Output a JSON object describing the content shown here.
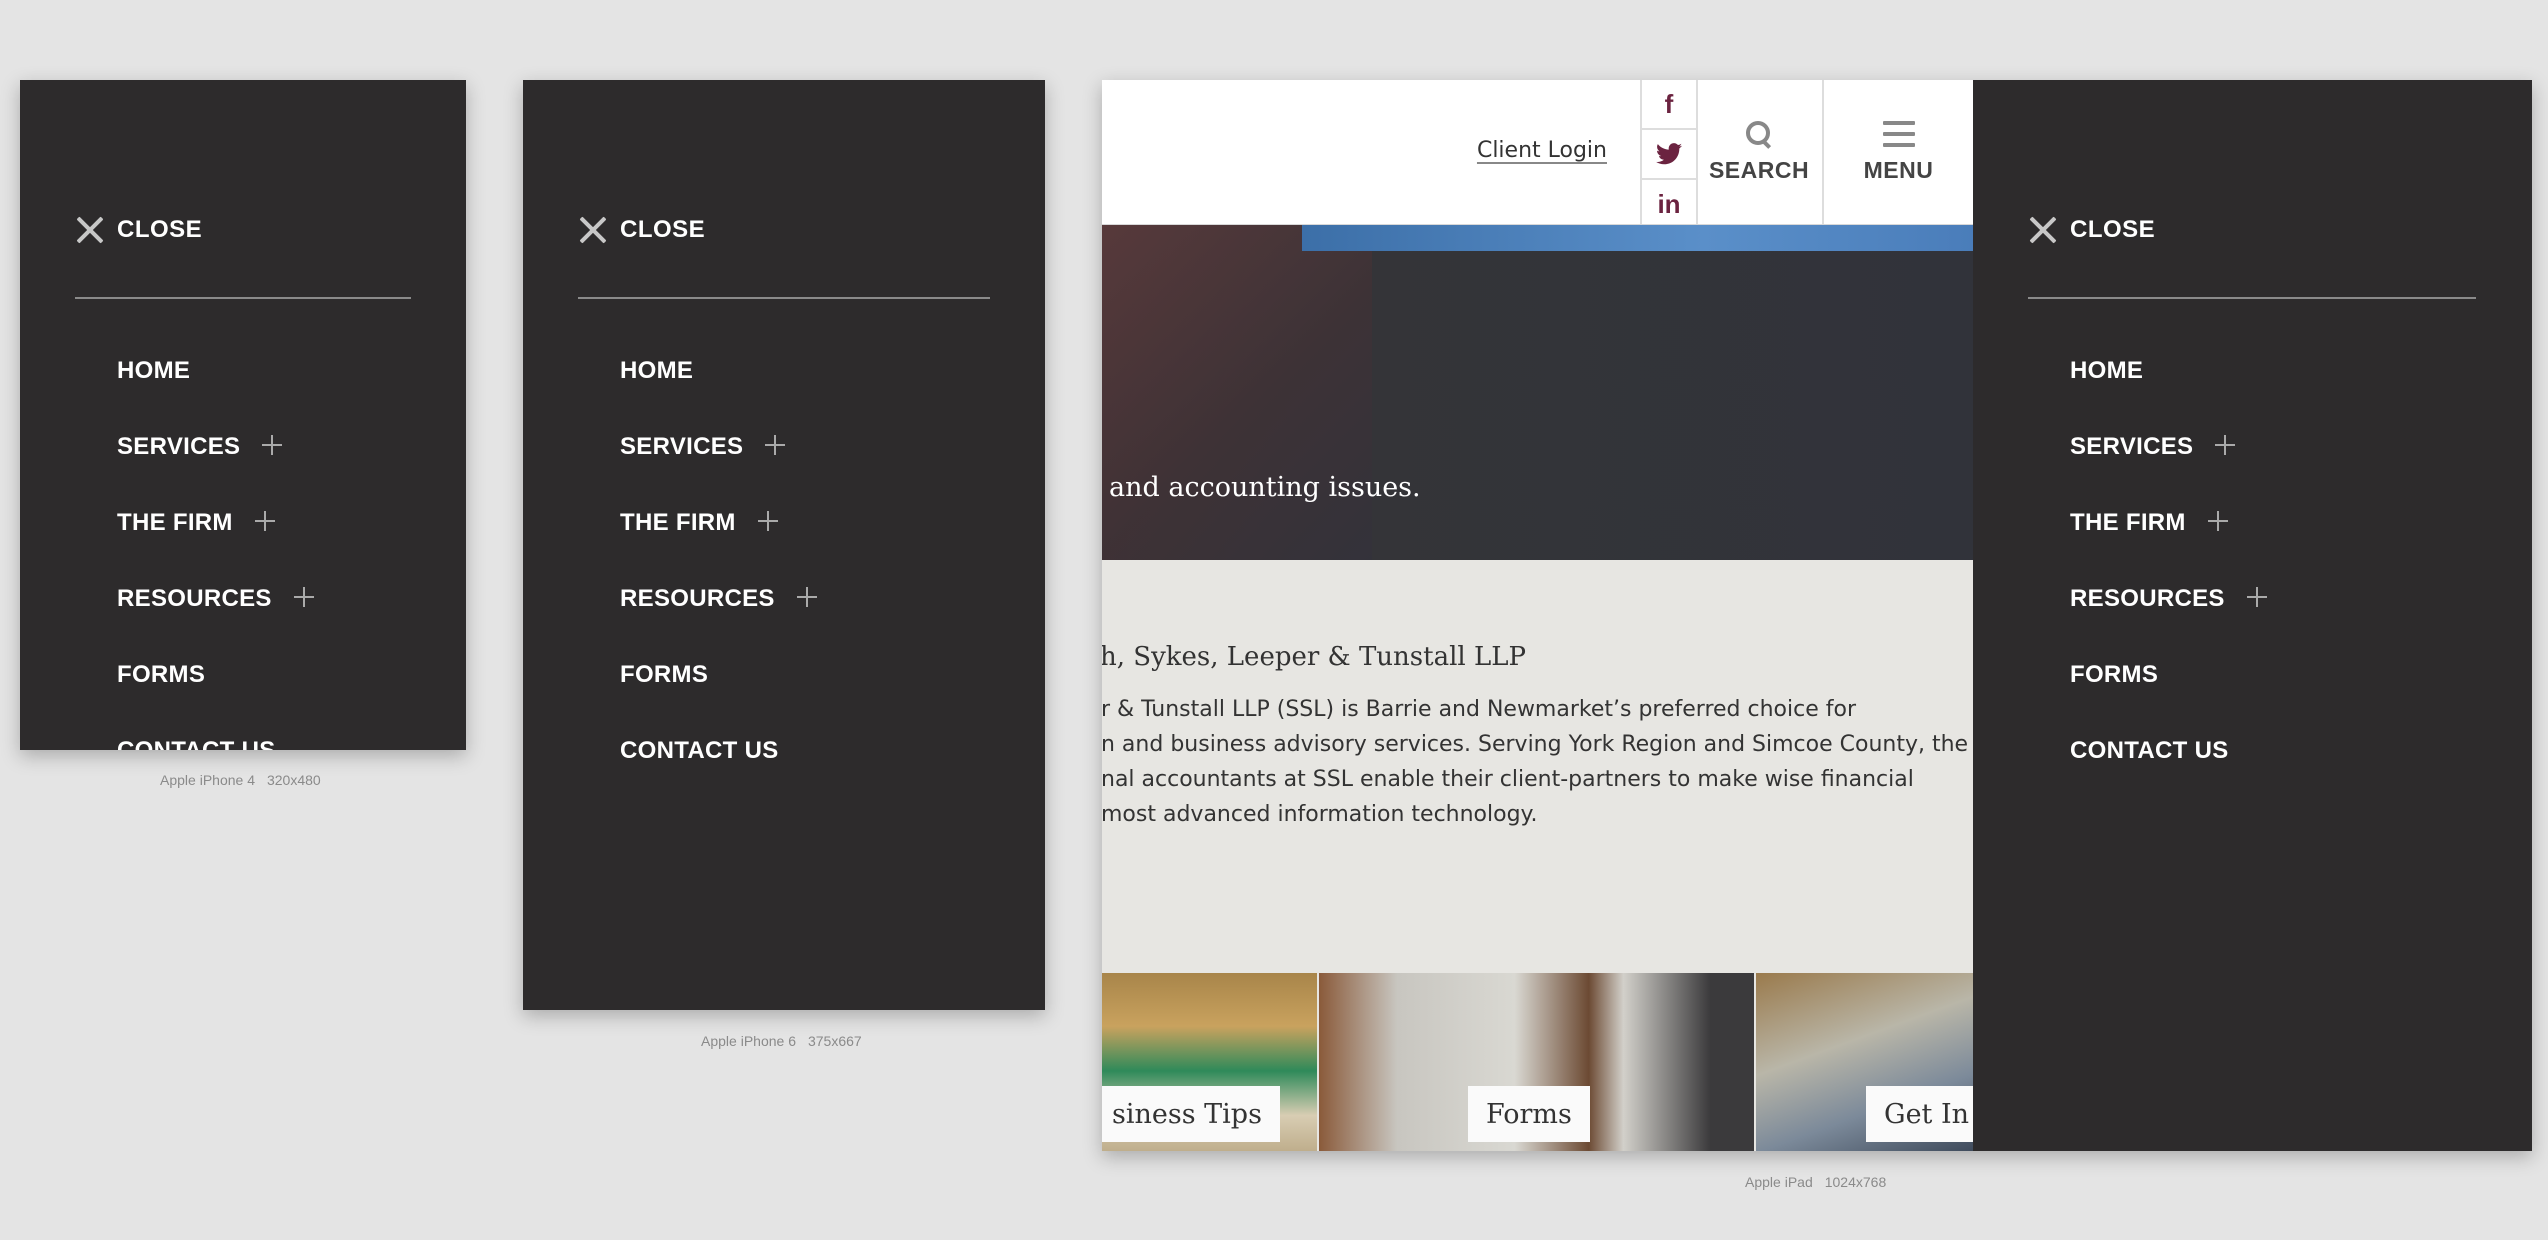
{
  "menu": {
    "close_label": "CLOSE",
    "items": [
      {
        "label": "HOME"
      },
      {
        "label": "SERVICES"
      },
      {
        "label": "THE FIRM"
      },
      {
        "label": "RESOURCES"
      },
      {
        "label": "FORMS"
      },
      {
        "label": "CONTACT US"
      }
    ]
  },
  "devices": [
    {
      "name": "Apple iPhone 4",
      "dims": "320x480"
    },
    {
      "name": "Apple iPhone 6",
      "dims": "375x667"
    },
    {
      "name": "Apple iPad",
      "dims": "1024x768"
    }
  ],
  "site": {
    "client_login": "Client Login",
    "social": {
      "facebook": "f",
      "twitter": "🐦",
      "linkedin": "in"
    },
    "search_label": "SEARCH",
    "menu_label": "MENU",
    "hero_text": "and accounting issues.",
    "about_title": "h, Sykes, Leeper & Tunstall LLP",
    "about_lines": [
      "r & Tunstall LLP (SSL) is Barrie and Newmarket’s preferred choice for",
      "n and business advisory services. Serving York Region and Simcoe County, the",
      "nal accountants at SSL enable their client-partners to make wise financial",
      "most advanced information technology."
    ],
    "tiles": [
      "siness Tips",
      "Forms",
      "Get In"
    ]
  },
  "colors": {
    "page_bg": "#e4e4e4",
    "menu_bg": "#2d2b2c",
    "social_icon": "#6b2340",
    "content_bg": "#e7e6e2"
  }
}
